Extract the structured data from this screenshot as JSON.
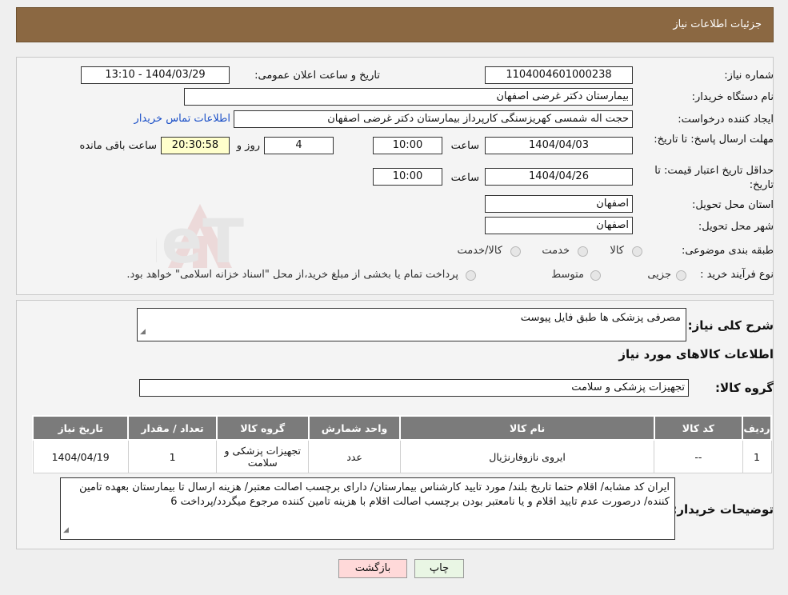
{
  "header": {
    "title": "جزئیات اطلاعات نیاز"
  },
  "form": {
    "need_number_label": "شماره نیاز:",
    "need_number": "1104004601000238",
    "announce_label": "تاریخ و ساعت اعلان عمومی:",
    "announce_value": "1404/03/29 - 13:10",
    "buyer_org_label": "نام دستگاه خریدار:",
    "buyer_org": "بیمارستان دکتر غرضی اصفهان",
    "creator_label": "ایجاد کننده درخواست:",
    "creator": "حجت اله شمسی کهریزسنگی کارپرداز بیمارستان دکتر غرضی اصفهان",
    "contact_link": "اطلاعات تماس خریدار",
    "deadline_label": "مهلت ارسال پاسخ: تا تاریخ:",
    "deadline_date": "1404/04/03",
    "time_label": "ساعت",
    "deadline_time": "10:00",
    "days_value": "4",
    "days_label": "روز و",
    "remaining_time": "20:30:58",
    "remaining_label": "ساعت باقی مانده",
    "min_validity_label": "حداقل تاریخ اعتبار قیمت: تا تاریخ:",
    "validity_date": "1404/04/26",
    "validity_time": "10:00",
    "province_label": "استان محل تحویل:",
    "province": "اصفهان",
    "city_label": "شهر محل تحویل:",
    "city": "اصفهان",
    "category_label": "طبقه بندی موضوعی:",
    "category_options": [
      "کالا",
      "خدمت",
      "کالا/خدمت"
    ],
    "process_label": "نوع فرآیند خرید :",
    "process_options": [
      "جزیی",
      "متوسط"
    ],
    "payment_note": "پرداخت تمام یا بخشی از مبلغ خرید،از محل \"اسناد خزانه اسلامی\" خواهد بود."
  },
  "details": {
    "summary_label": "شرح کلی نیاز:",
    "summary": "مصرفی پزشکی ها طبق فایل پیوست",
    "goods_title": "اطلاعات کالاهای مورد نیاز",
    "goods_group_label": "گروه کالا:",
    "goods_group": "تجهیزات پزشکی و سلامت",
    "table": {
      "headers": [
        "ردیف",
        "کد کالا",
        "نام کالا",
        "واحد شمارش",
        "گروه کالا",
        "تعداد / مقدار",
        "تاریخ نیاز"
      ],
      "rows": [
        [
          "1",
          "--",
          "ایروی نازوفارنژیال",
          "عدد",
          "تجهیزات پزشکی و سلامت",
          "1",
          "1404/04/19"
        ]
      ]
    },
    "buyer_notes_label": "توضیحات خریدار:",
    "buyer_notes": "ایران کد مشابه/ اقلام حتما تاریخ بلند/ مورد تایید کارشناس بیمارستان/ دارای برچسب اصالت معتبر/ هزینه ارسال تا بیمارستان بعهده تامین کننده/ درصورت عدم تایید اقلام و یا نامعتبر بودن برچسب اصالت اقلام با هزینه تامین کننده مرجوع میگردد/پرداخت 6"
  },
  "buttons": {
    "print": "چاپ",
    "back": "بازگشت"
  },
  "watermark": {
    "text": "AriaTender.neT"
  },
  "colors": {
    "header": "#8b6842",
    "table_header": "#7b7b7b",
    "link": "#1a4fc7",
    "back_button": "#ffd9d9"
  }
}
